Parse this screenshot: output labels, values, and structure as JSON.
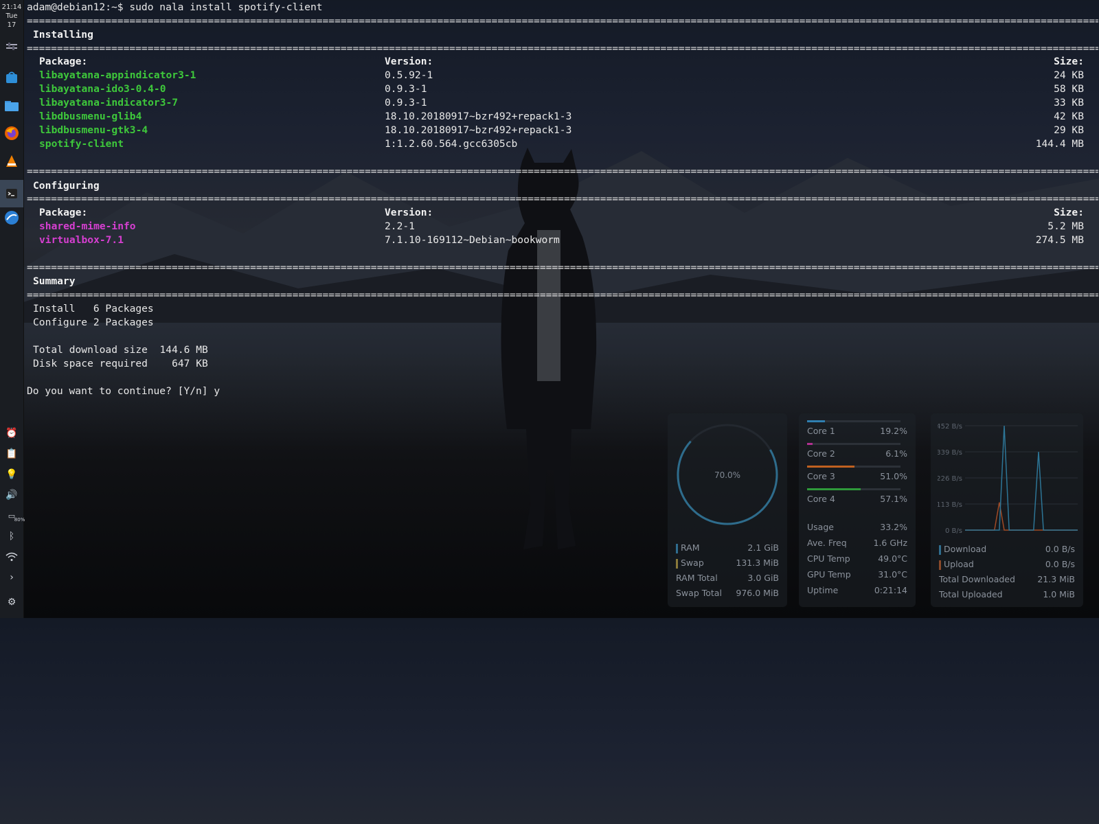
{
  "dock": {
    "clock": {
      "time": "21:14",
      "day": "Tue",
      "date": "17"
    },
    "apps": [
      {
        "name": "panel-settings-icon"
      },
      {
        "name": "software-store-icon"
      },
      {
        "name": "file-manager-icon"
      },
      {
        "name": "firefox-icon"
      },
      {
        "name": "vlc-icon"
      },
      {
        "name": "terminal-icon",
        "active": true
      },
      {
        "name": "browser-icon"
      }
    ],
    "tray": {
      "battery_label": "80%"
    }
  },
  "terminal": {
    "prompt": "adam@debian12:~$ sudo nala install spotify-client",
    "separator": "====================================================================================================================================================================================================================",
    "installing": {
      "title": "Installing",
      "col_package": "Package:",
      "col_version": "Version:",
      "col_size": "Size:",
      "rows": [
        {
          "package": "libayatana-appindicator3-1",
          "version": "0.5.92-1",
          "size": "24 KB"
        },
        {
          "package": "libayatana-ido3-0.4-0",
          "version": "0.9.3-1",
          "size": "58 KB"
        },
        {
          "package": "libayatana-indicator3-7",
          "version": "0.9.3-1",
          "size": "33 KB"
        },
        {
          "package": "libdbusmenu-glib4",
          "version": "18.10.20180917~bzr492+repack1-3",
          "size": "42 KB"
        },
        {
          "package": "libdbusmenu-gtk3-4",
          "version": "18.10.20180917~bzr492+repack1-3",
          "size": "29 KB"
        },
        {
          "package": "spotify-client",
          "version": "1:1.2.60.564.gcc6305cb",
          "size": "144.4 MB"
        }
      ]
    },
    "configuring": {
      "title": "Configuring",
      "col_package": "Package:",
      "col_version": "Version:",
      "col_size": "Size:",
      "rows": [
        {
          "package": "shared-mime-info",
          "version": "2.2-1",
          "size": "5.2 MB"
        },
        {
          "package": "virtualbox-7.1",
          "version": "7.1.10-169112~Debian~bookworm",
          "size": "274.5 MB"
        }
      ]
    },
    "summary": {
      "title": "Summary",
      "lines": [
        "Install   6 Packages",
        "Configure 2 Packages",
        "",
        "Total download size  144.6 MB",
        "Disk space required    647 KB"
      ],
      "question": "Do you want to continue? [Y/n] y"
    }
  },
  "conky": {
    "memory": {
      "gauge_percent": 70.0,
      "gauge_label": "70.0%",
      "rows": [
        {
          "key": "RAM",
          "value": "2.1 GiB",
          "marker": "#2f6d8f"
        },
        {
          "key": "Swap",
          "value": "131.3 MiB",
          "marker": "#8a7a3a"
        },
        {
          "key": "RAM Total",
          "value": "3.0 GiB"
        },
        {
          "key": "Swap Total",
          "value": "976.0 MiB"
        }
      ]
    },
    "cpu": {
      "cores": [
        {
          "label": "Core 1",
          "value": "19.2%",
          "fraction": 0.192,
          "color": "#2f7fb0"
        },
        {
          "label": "Core 2",
          "value": "6.1%",
          "fraction": 0.061,
          "color": "#b03090"
        },
        {
          "label": "Core 3",
          "value": "51.0%",
          "fraction": 0.51,
          "color": "#c06020"
        },
        {
          "label": "Core 4",
          "value": "57.1%",
          "fraction": 0.571,
          "color": "#2e9a3a"
        }
      ],
      "stats": [
        {
          "key": "Usage",
          "value": "33.2%"
        },
        {
          "key": "Ave. Freq",
          "value": "1.6 GHz"
        },
        {
          "key": "CPU Temp",
          "value": "49.0°C"
        },
        {
          "key": "GPU Temp",
          "value": "31.0°C"
        },
        {
          "key": "Uptime",
          "value": "0:21:14"
        }
      ]
    },
    "network": {
      "ticks": [
        "452 B/s",
        "339 B/s",
        "226 B/s",
        "113 B/s",
        "0 B/s"
      ],
      "rows": [
        {
          "key": "Download",
          "value": "0.0 B/s",
          "marker": "#2f6d8f"
        },
        {
          "key": "Upload",
          "value": "0.0 B/s",
          "marker": "#8a4a2a"
        },
        {
          "key": "Total Downloaded",
          "value": "21.3 MiB"
        },
        {
          "key": "Total Uploaded",
          "value": "1.0 MiB"
        }
      ],
      "download_series": [
        0,
        0,
        0,
        0,
        0,
        0,
        0,
        0,
        452,
        0,
        0,
        0,
        0,
        0,
        0,
        339,
        0,
        0,
        0,
        0,
        0,
        0,
        0,
        0
      ],
      "upload_series": [
        0,
        0,
        0,
        0,
        0,
        0,
        0,
        120,
        0,
        0,
        0,
        0,
        0,
        0,
        0,
        0,
        0,
        0,
        0,
        0,
        0,
        0,
        0,
        0
      ]
    }
  }
}
